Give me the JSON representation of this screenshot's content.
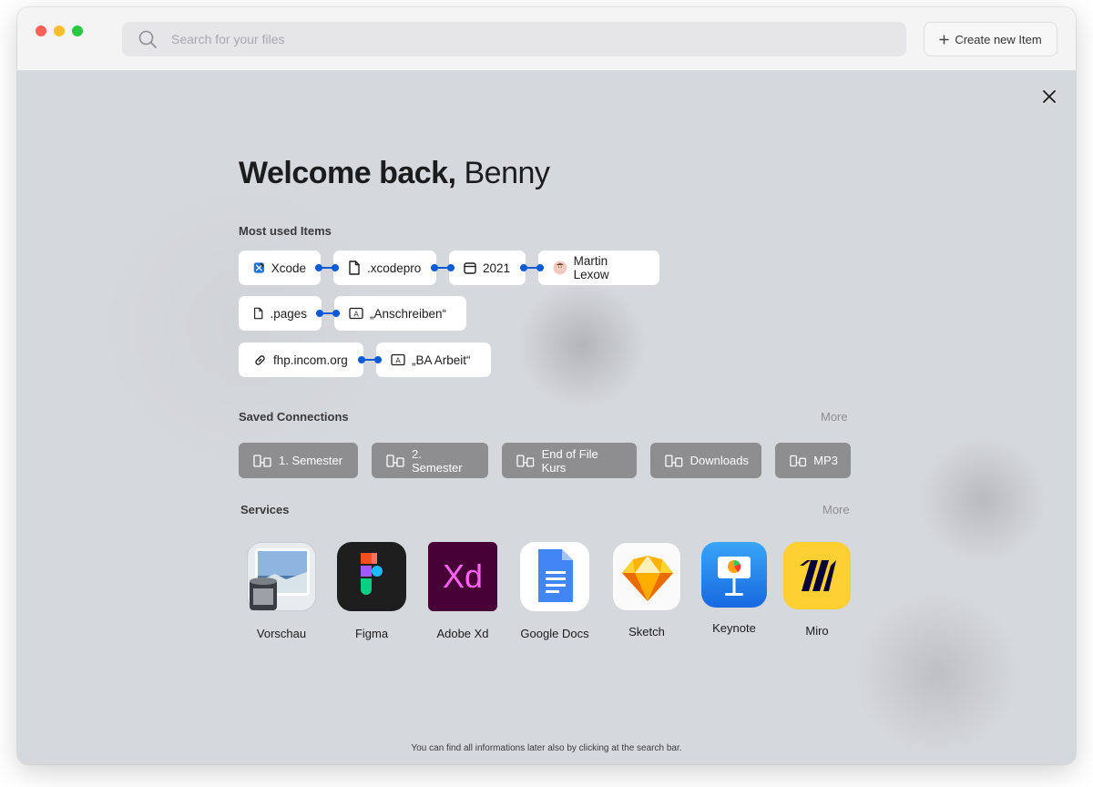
{
  "search": {
    "placeholder": "Search for your files"
  },
  "toolbar": {
    "create_label": "Create new Item"
  },
  "welcome": {
    "greeting": "Welcome back,",
    "name": "Benny"
  },
  "most_used": {
    "title": "Most used Items",
    "rows": [
      [
        {
          "label": "Xcode",
          "icon": "xcode-icon"
        },
        {
          "label": ".xcodepro",
          "icon": "document-icon"
        },
        {
          "label": "2021",
          "icon": "calendar-icon"
        },
        {
          "label": "Martin Lexow",
          "icon": "avatar-icon"
        }
      ],
      [
        {
          "label": ".pages",
          "icon": "document-icon"
        },
        {
          "label": "„Anschreiben“",
          "icon": "text-box-icon"
        }
      ],
      [
        {
          "label": "fhp.incom.org",
          "icon": "link-icon"
        },
        {
          "label": "„BA Arbeit“",
          "icon": "text-box-icon"
        }
      ]
    ]
  },
  "saved_connections": {
    "title": "Saved Connections",
    "more": "More",
    "items": [
      "1. Semester",
      "2. Semester",
      "End of File Kurs",
      "Downloads",
      "MP3"
    ]
  },
  "services": {
    "title": "Services",
    "more": "More",
    "items": [
      {
        "label": "Vorschau",
        "icon": "vorschau-icon"
      },
      {
        "label": "Figma",
        "icon": "figma-icon"
      },
      {
        "label": "Adobe Xd",
        "icon": "adobe-xd-icon"
      },
      {
        "label": "Google Docs",
        "icon": "google-docs-icon"
      },
      {
        "label": "Sketch",
        "icon": "sketch-icon"
      },
      {
        "label": "Keynote",
        "icon": "keynote-icon"
      },
      {
        "label": "Miro",
        "icon": "miro-icon"
      }
    ]
  },
  "footer": {
    "note": "You can find all informations later also by clicking at the search bar."
  },
  "colors": {
    "accent": "#0a5bd6",
    "connection_chip": "#8e8e91",
    "background": "#d5d8dc"
  }
}
